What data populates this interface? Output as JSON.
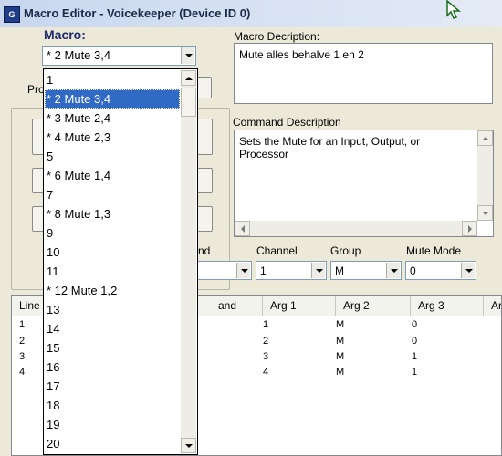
{
  "window": {
    "title": "Macro Editor - Voicekeeper (Device ID 0)",
    "icon_letter": "G"
  },
  "macro": {
    "label": "Macro:",
    "selected": "* 2 Mute 3,4",
    "options": [
      "1",
      "* 2 Mute 3,4",
      "* 3 Mute 2,4",
      "* 4 Mute 2,3",
      "5",
      "* 6 Mute 1,4",
      "7",
      "* 8 Mute 1,3",
      "9",
      "10",
      "11",
      "* 12 Mute 1,2",
      "13",
      "14",
      "15",
      "16",
      "17",
      "18",
      "19",
      "20"
    ],
    "highlighted_index": 1
  },
  "macro_description": {
    "label": "Macro Decription:",
    "value": "Mute alles behalve 1 en 2"
  },
  "partial_labels": {
    "pro": "Pro",
    "command_suffix": "nd"
  },
  "command_description": {
    "label": "Command Description",
    "value": "Sets the Mute for an Input, Output, or Processor"
  },
  "params": {
    "channel": {
      "label": "Channel",
      "value": "1"
    },
    "group": {
      "label": "Group",
      "value": "M"
    },
    "mute_mode": {
      "label": "Mute Mode",
      "value": "0"
    }
  },
  "table": {
    "columns": [
      "Line",
      "and",
      "Arg 1",
      "Arg 2",
      "Arg 3",
      "Ar"
    ],
    "rows": [
      {
        "line": "1",
        "arg1": "1",
        "arg2": "M",
        "arg3": "0"
      },
      {
        "line": "2",
        "arg1": "2",
        "arg2": "M",
        "arg3": "0"
      },
      {
        "line": "3",
        "arg1": "3",
        "arg2": "M",
        "arg3": "1"
      },
      {
        "line": "4",
        "arg1": "4",
        "arg2": "M",
        "arg3": "1"
      }
    ]
  },
  "colors": {
    "window_bg": "#ece9d8",
    "selection": "#316ac5",
    "titlebar": "#c8d6ee"
  }
}
